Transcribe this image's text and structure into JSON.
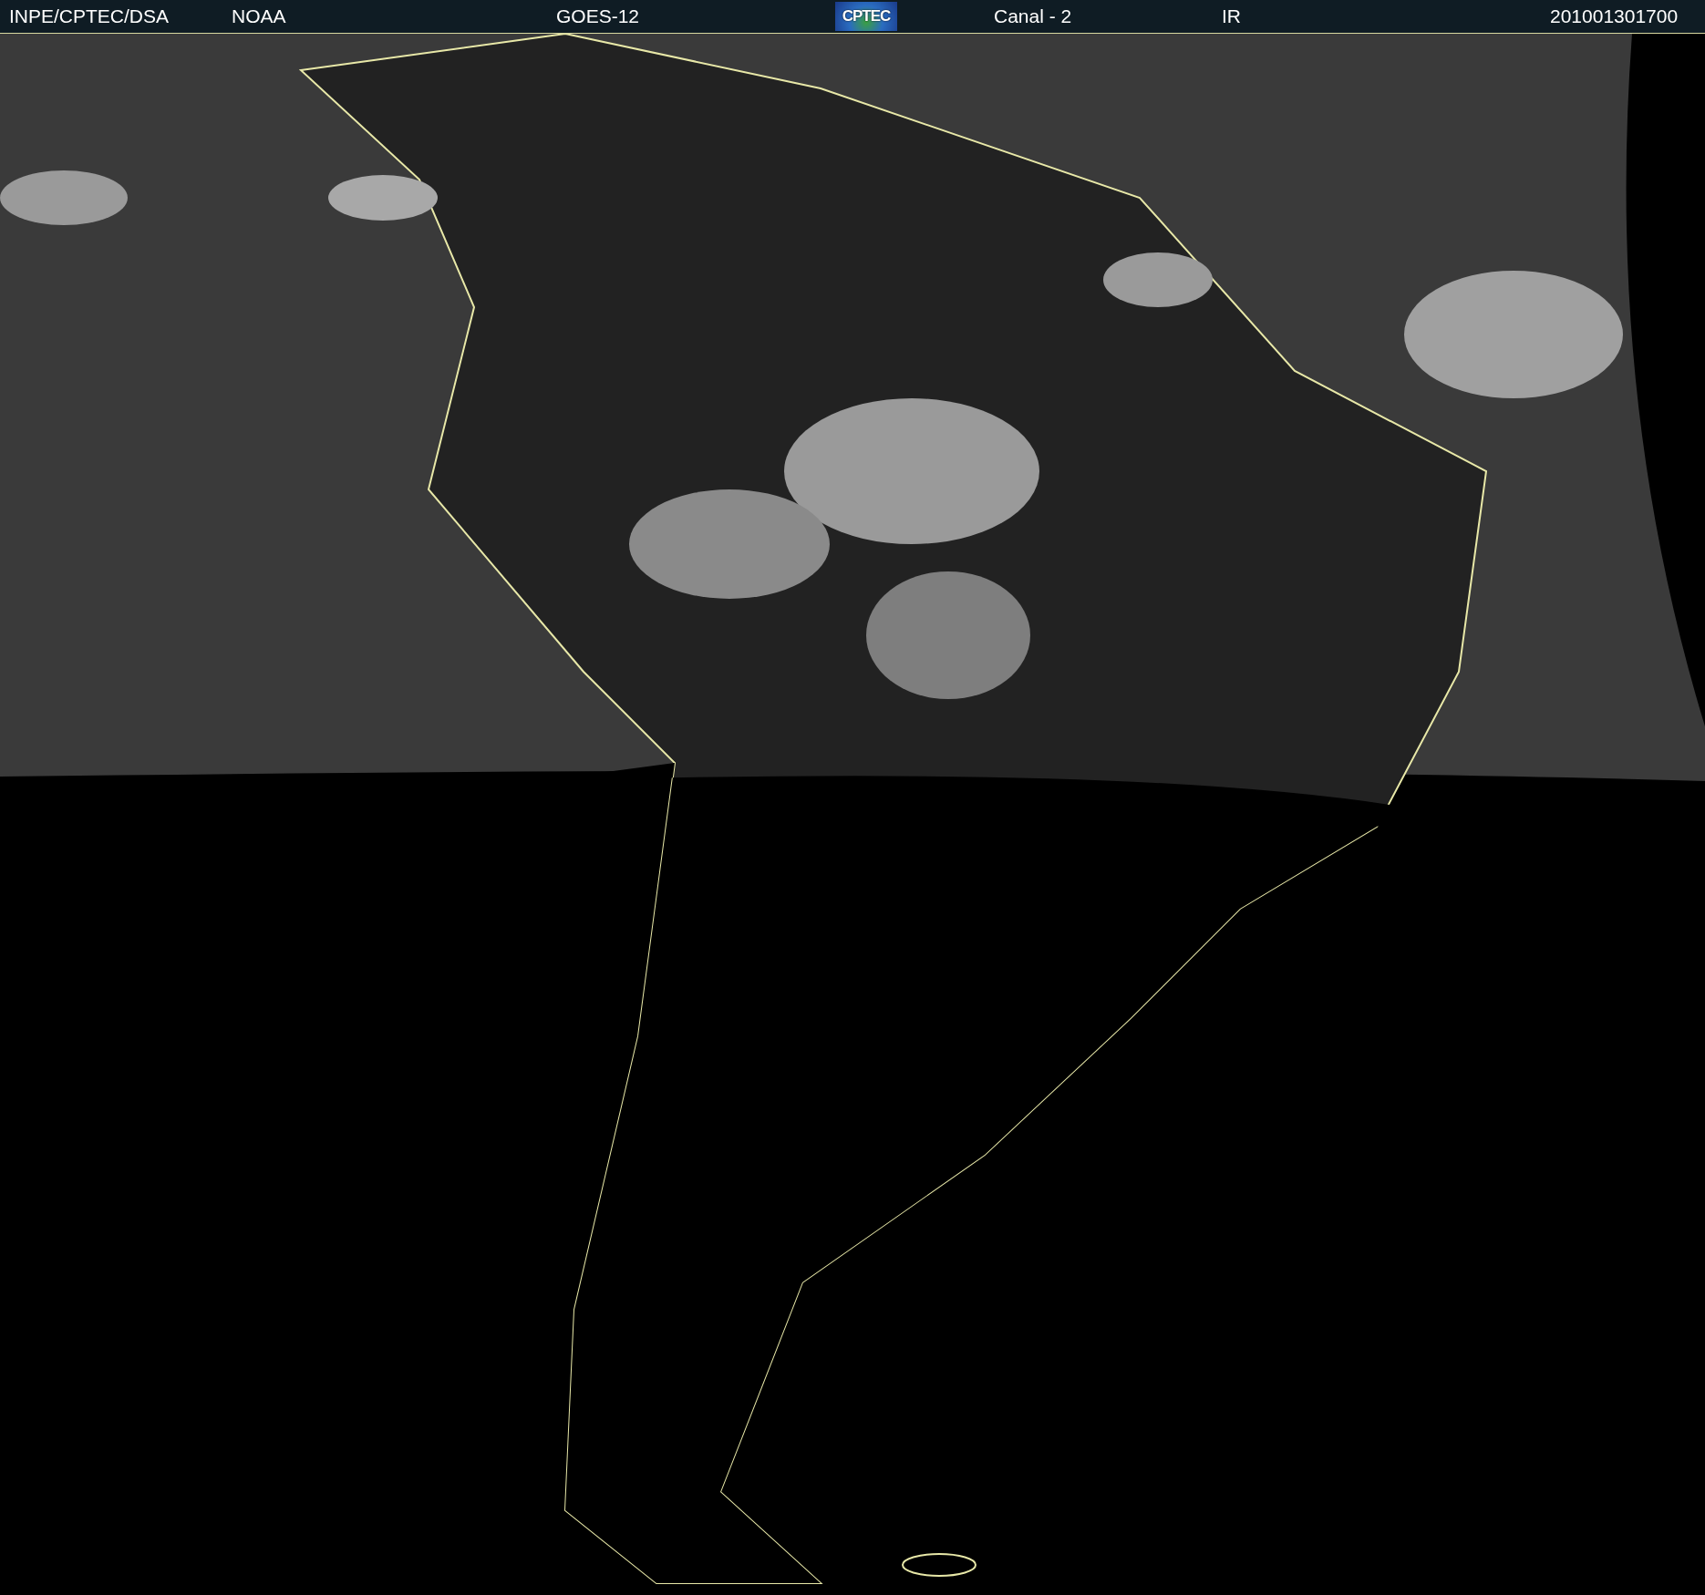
{
  "header": {
    "source": "INPE/CPTEC/DSA",
    "agency": "NOAA",
    "satellite": "GOES-12",
    "logo_text": "CPTEC",
    "channel": "Canal - 2",
    "band": "IR",
    "timestamp": "201001301700"
  }
}
